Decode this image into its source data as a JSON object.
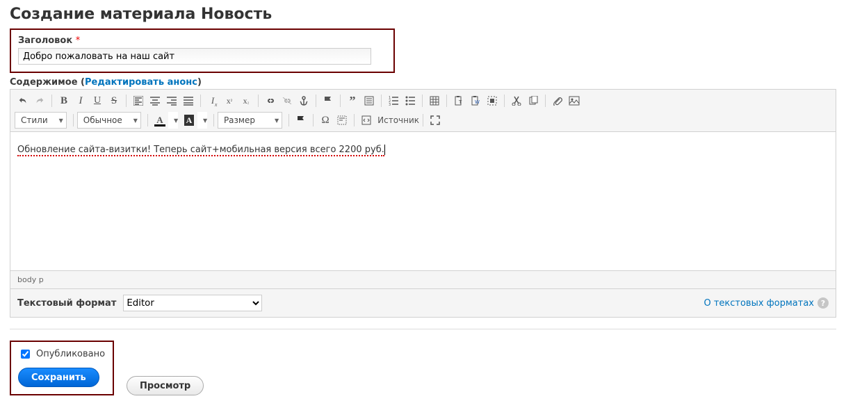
{
  "page_title": "Создание материала Новость",
  "title_field": {
    "label": "Заголовок",
    "value": "Добро пожаловать на наш сайт"
  },
  "content_section": {
    "label": "Содержимое",
    "edit_teaser_link": "Редактировать анонс"
  },
  "toolbar": {
    "styles_dd": "Стили",
    "format_dd": "Обычное",
    "size_dd": "Размер",
    "source_label": "Источник"
  },
  "editor": {
    "body_text": "Обновление сайта-визитки! Теперь сайт+мобильная версия всего 2200 руб.",
    "path": "body  p"
  },
  "format_bar": {
    "label": "Текстовый формат",
    "selected": "Editor",
    "about_link": "О текстовых форматах"
  },
  "published": {
    "label": "Опубликовано",
    "checked": true
  },
  "buttons": {
    "save": "Сохранить",
    "preview": "Просмотр"
  }
}
